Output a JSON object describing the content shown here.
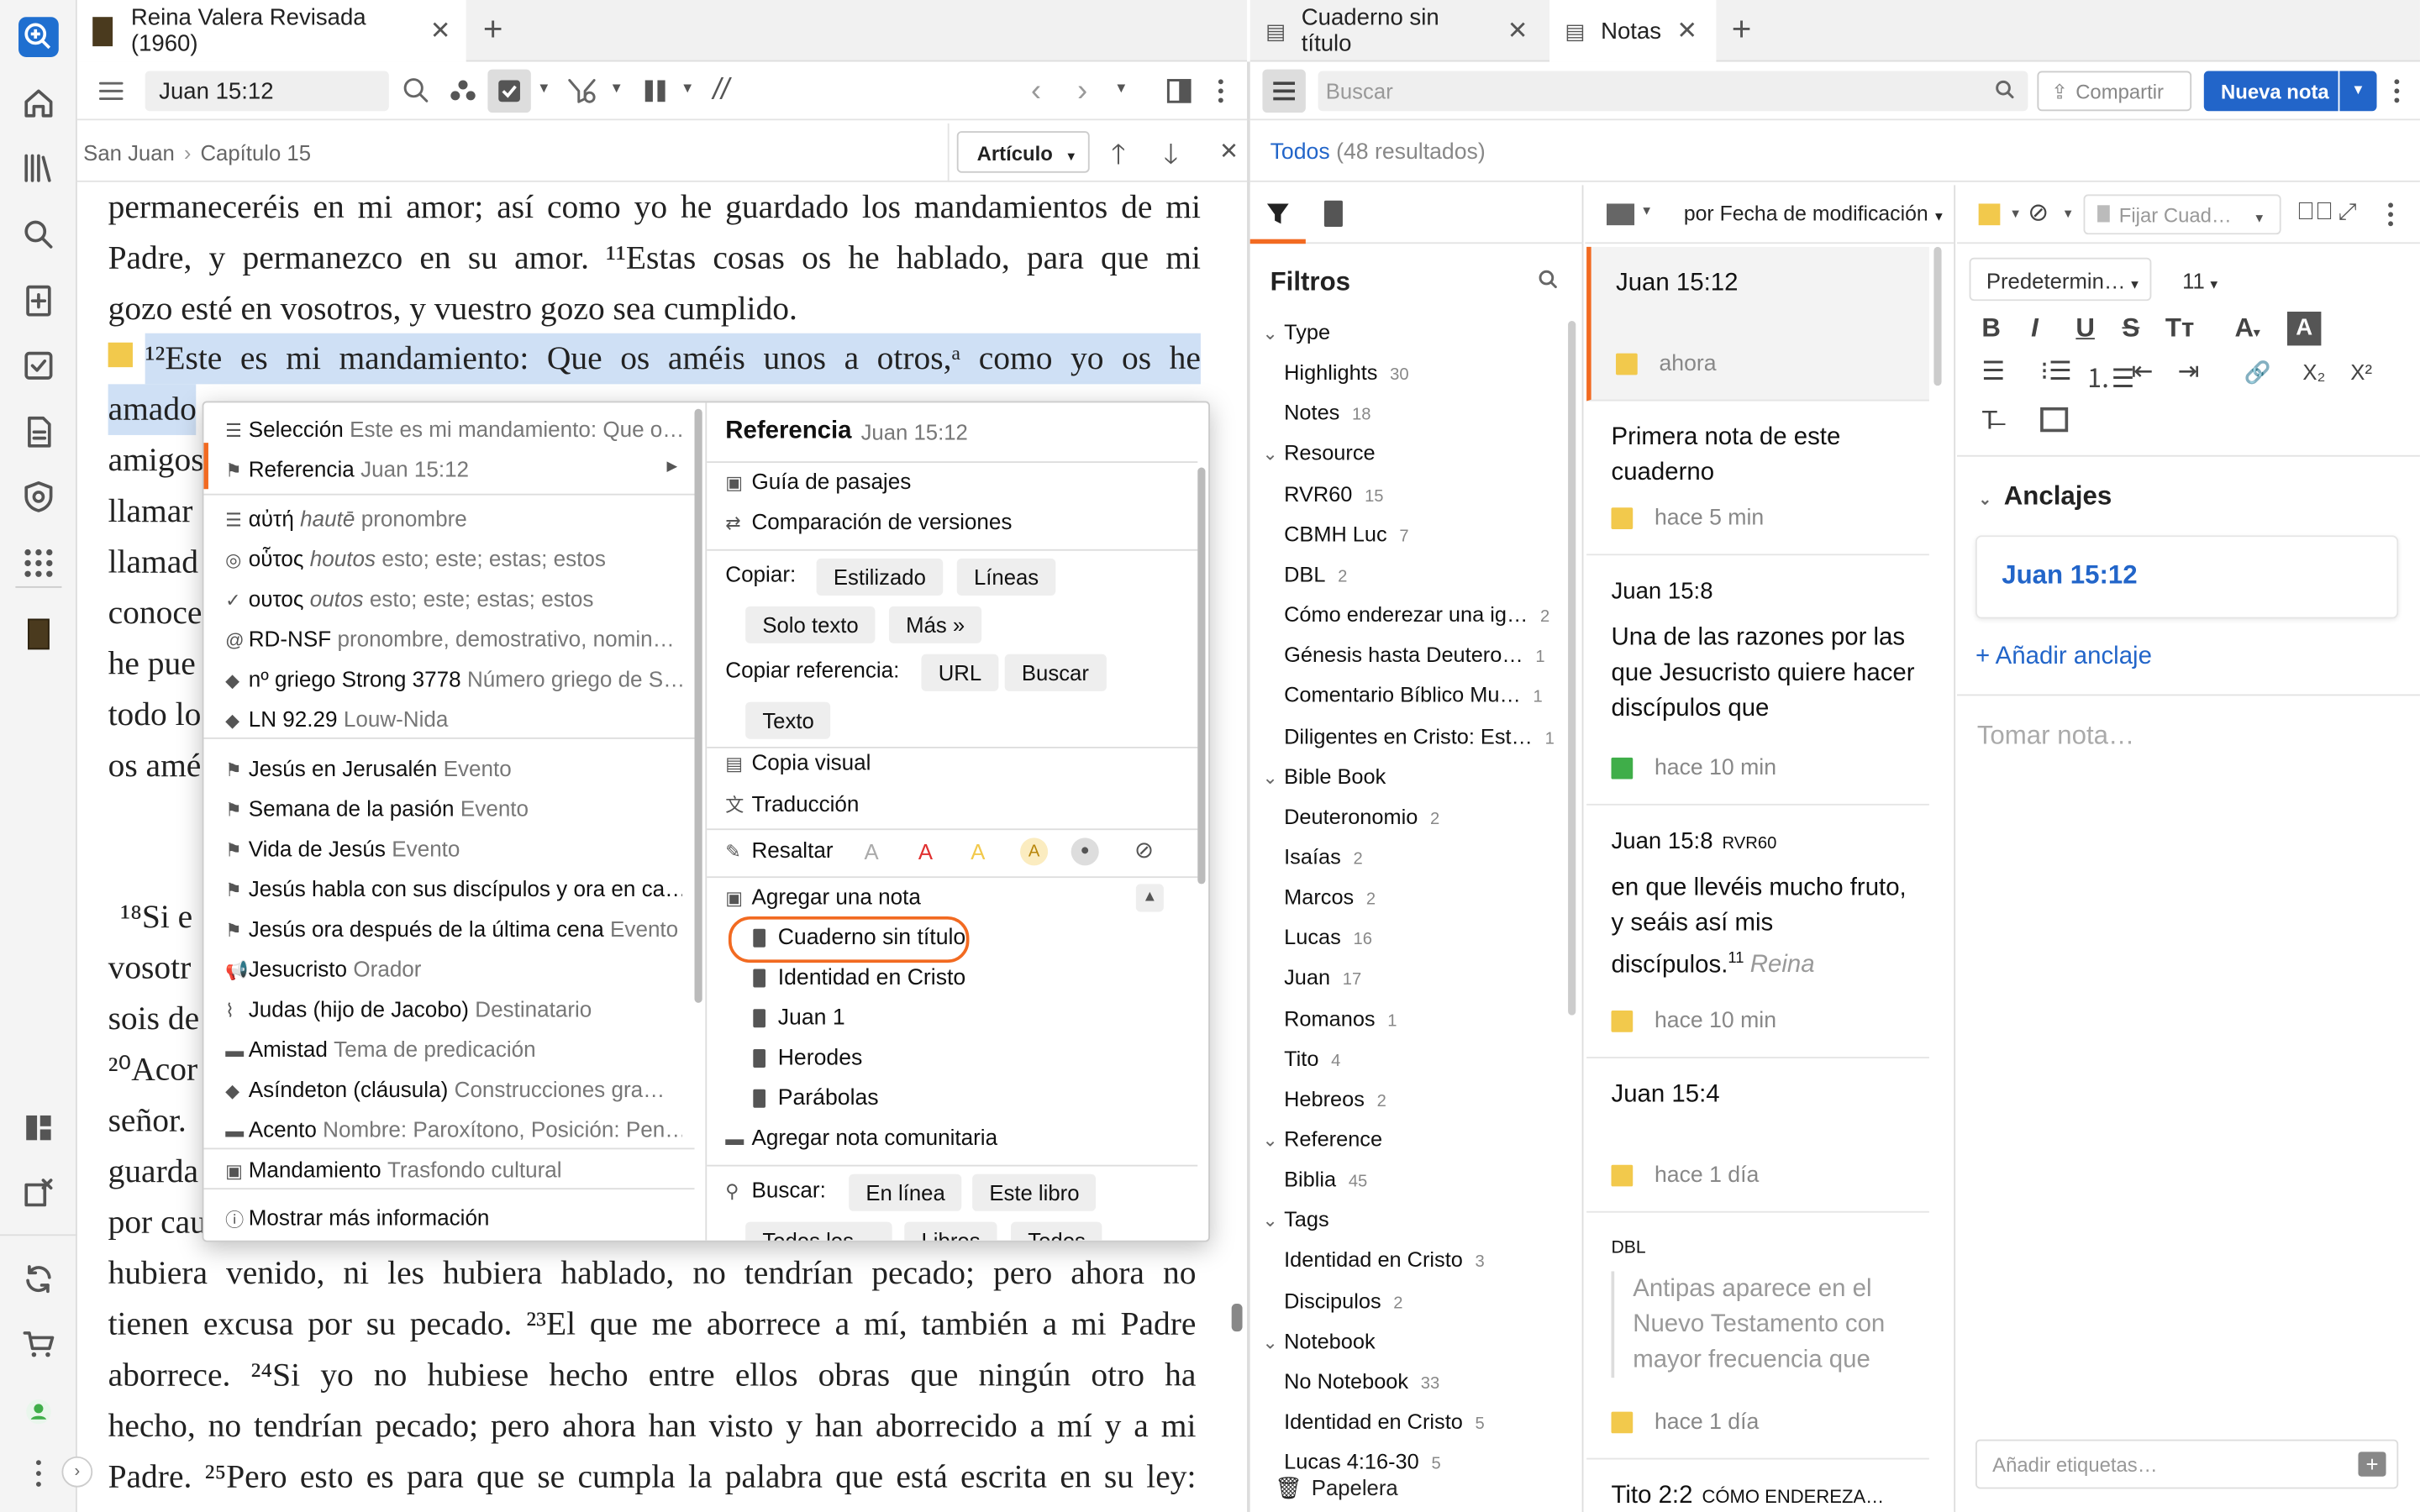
{
  "tabs": {
    "left": {
      "title": "Reina Valera Revisada (1960)"
    },
    "right": [
      {
        "title": "Cuaderno sin título"
      },
      {
        "title": "Notas"
      }
    ]
  },
  "bible": {
    "reference": "Juan 15:12",
    "breadcrumb": [
      "San Juan",
      "Capítulo 15"
    ],
    "view_mode": "Artículo",
    "lines": [
      "permaneceréis en mi amor; así como yo he guardado los mandamientos de mi",
      "Padre, y permanezco en su amor. ¹¹Estas cosas os he hablado, para que mi",
      "gozo esté en vosotros, y vuestro gozo sea cumplido.",
      "¹²Este es mi mandamiento: Que os améis unos a otros,ᵃ como yo os he",
      "amado",
      "amigos",
      "llamar",
      "llamad",
      "conoce",
      "he pue",
      "todo lo",
      "os amé",
      "¹⁸Si e",
      "vosotr",
      "sois de",
      "²⁰Acor",
      "señor.",
      "guarda",
      "por cau",
      "hubiera venido, ni les hubiera hablado, no tendrían pecado; pero ahora no",
      "tienen excusa por su pecado. ²³El que me aborrece a mí, también a mi Padre",
      "aborrece. ²⁴Si yo no hubiese hecho entre ellos obras que ningún otro ha",
      "hecho, no tendrían pecado; pero ahora han visto y han aborrecido a mí y a mi",
      "Padre. ²⁵Pero esto es para que se cumpla la palabra que está escrita en su ley:"
    ]
  },
  "context_menu": {
    "left_items": [
      {
        "label": "Selección",
        "sub": "Este es mi mandamiento: Que o…"
      },
      {
        "label": "Referencia",
        "sub": "Juan 15:12"
      },
      {
        "label": "αὐτή",
        "italic": "hautē",
        "sub": "pronombre"
      },
      {
        "label": "οὗτος",
        "italic": "houtos",
        "sub": "esto; este; estas; estos"
      },
      {
        "label": "ουτος",
        "italic": "outos",
        "sub": "esto; este; estas; estos"
      },
      {
        "label": "RD-NSF",
        "sub": "pronombre, demostrativo, nomin…"
      },
      {
        "label": "nº griego Strong 3778",
        "sub": "Número griego de S…"
      },
      {
        "label": "LN 92.29",
        "sub": "Louw-Nida"
      },
      {
        "label": "Jesús en Jerusalén",
        "sub": "Evento"
      },
      {
        "label": "Semana de la pasión",
        "sub": "Evento"
      },
      {
        "label": "Vida de Jesús",
        "sub": "Evento"
      },
      {
        "label": "Jesús habla con sus discípulos y ora en ca…",
        "sub": ""
      },
      {
        "label": "Jesús ora después de la última cena",
        "sub": "Evento"
      },
      {
        "label": "Jesucristo",
        "sub": "Orador"
      },
      {
        "label": "Judas (hijo de Jacobo)",
        "sub": "Destinatario"
      },
      {
        "label": "Amistad",
        "sub": "Tema de predicación"
      },
      {
        "label": "Asíndeton (cláusula)",
        "sub": "Construcciones gra…"
      },
      {
        "label": "Acento",
        "sub": "Nombre: Paroxítono, Posición: Pen…"
      },
      {
        "label": "Mandamiento",
        "sub": "Trasfondo cultural"
      },
      {
        "label": "Mostrar más información",
        "sub": ""
      }
    ],
    "right": {
      "title": "Referencia",
      "title_ref": "Juan 15:12",
      "guide": "Guía de pasajes",
      "compare": "Comparación de versiones",
      "copy_label": "Copiar:",
      "copy_opts": [
        "Estilizado",
        "Líneas",
        "Solo texto",
        "Más »"
      ],
      "copyref_label": "Copiar referencia:",
      "copyref_opts": [
        "URL",
        "Buscar",
        "Texto"
      ],
      "visual": "Copia visual",
      "translation": "Traducción",
      "highlight": "Resaltar",
      "add_note": "Agregar una nota",
      "notebooks": [
        "Cuaderno sin título",
        "Identidad en Cristo",
        "Juan 1",
        "Herodes",
        "Parábolas"
      ],
      "community": "Agregar nota comunitaria",
      "search_label": "Buscar:",
      "search_opts": [
        "En línea",
        "Este libro"
      ],
      "search_opts2": [
        "Todos los…",
        "Libros",
        "Todos"
      ]
    }
  },
  "notes": {
    "search_placeholder": "Buscar",
    "share": "Compartir",
    "new_note": "Nueva nota",
    "all": "Todos",
    "count": "(48 resultados)",
    "sort": "por Fecha de modificación",
    "filters_title": "Filtros",
    "filters": [
      {
        "type": "h",
        "label": "Type"
      },
      {
        "type": "i",
        "label": "Highlights",
        "count": "30"
      },
      {
        "type": "i",
        "label": "Notes",
        "count": "18"
      },
      {
        "type": "h",
        "label": "Resource"
      },
      {
        "type": "i",
        "label": "RVR60",
        "count": "15"
      },
      {
        "type": "i",
        "label": "CBMH Luc",
        "count": "7"
      },
      {
        "type": "i",
        "label": "DBL",
        "count": "2"
      },
      {
        "type": "i",
        "label": "Cómo enderezar una ig…",
        "count": "2"
      },
      {
        "type": "i",
        "label": "Génesis hasta Deutero…",
        "count": "1"
      },
      {
        "type": "i",
        "label": "Comentario Bíblico Mu…",
        "count": "1"
      },
      {
        "type": "i",
        "label": "Diligentes en Cristo: Est…",
        "count": "1"
      },
      {
        "type": "h",
        "label": "Bible Book"
      },
      {
        "type": "i",
        "label": "Deuteronomio",
        "count": "2"
      },
      {
        "type": "i",
        "label": "Isaías",
        "count": "2"
      },
      {
        "type": "i",
        "label": "Marcos",
        "count": "2"
      },
      {
        "type": "i",
        "label": "Lucas",
        "count": "16"
      },
      {
        "type": "i",
        "label": "Juan",
        "count": "17"
      },
      {
        "type": "i",
        "label": "Romanos",
        "count": "1"
      },
      {
        "type": "i",
        "label": "Tito",
        "count": "4"
      },
      {
        "type": "i",
        "label": "Hebreos",
        "count": "2"
      },
      {
        "type": "h",
        "label": "Reference"
      },
      {
        "type": "i",
        "label": "Biblia",
        "count": "45"
      },
      {
        "type": "h",
        "label": "Tags"
      },
      {
        "type": "i",
        "label": "Identidad en Cristo",
        "count": "3"
      },
      {
        "type": "i",
        "label": "Discipulos",
        "count": "2"
      },
      {
        "type": "h",
        "label": "Notebook"
      },
      {
        "type": "i",
        "label": "No Notebook",
        "count": "33"
      },
      {
        "type": "i",
        "label": "Identidad en Cristo",
        "count": "5"
      },
      {
        "type": "i",
        "label": "Lucas 4:16-30",
        "count": "5"
      }
    ],
    "trash": "Papelera",
    "cards": [
      {
        "title": "Juan 15:12",
        "time": "ahora",
        "color": "#f2c94c"
      },
      {
        "title": "Primera nota de este cuaderno",
        "time": "hace 5 min",
        "color": "#f2c94c"
      },
      {
        "ref": "Juan 15:8",
        "title": "Una de las razones por las que Jesucristo quiere hacer discípulos que",
        "time": "hace 10 min",
        "color": "#3fae49"
      },
      {
        "ref": "Juan 15:8",
        "ref_res": "RVR60",
        "title": "en que llevéis mucho fruto, y seáis así mis discípulos.",
        "sup": "11",
        "italic": "Reina",
        "time": "hace 10 min",
        "color": "#f2c94c"
      },
      {
        "title": "Juan 15:4",
        "time": "hace 1 día",
        "color": "#f2c94c"
      },
      {
        "res": "DBL",
        "title": "Antipas aparece en el Nuevo Testamento con mayor frecuencia que",
        "time": "hace 1 día",
        "color": "#f2c94c"
      },
      {
        "title": "Tito 2:2",
        "res2": "CÓMO ENDEREZA…"
      }
    ]
  },
  "editor": {
    "pin": "Fijar Cuad…",
    "font": "Predetermin…",
    "size": "11",
    "anchors_title": "Anclajes",
    "anchor": "Juan 15:12",
    "add_anchor": "+ Añadir anclaje",
    "placeholder": "Tomar nota…",
    "tags_placeholder": "Añadir etiquetas…"
  },
  "colors": {
    "accent": "#2265c9",
    "highlight": "#cfe0f5",
    "callout": "#f26a21"
  }
}
